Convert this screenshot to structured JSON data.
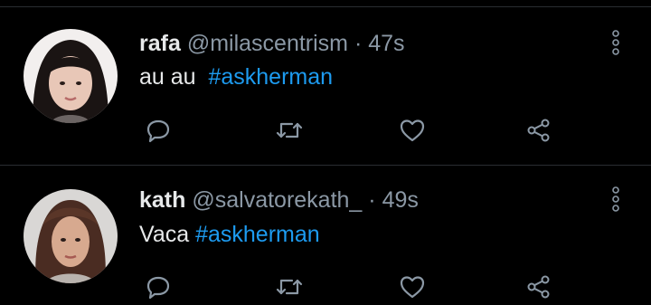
{
  "tweets": [
    {
      "name": "rafa",
      "handle": "@milascentrism",
      "separator": "·",
      "time": "47s",
      "text_prefix": "au au",
      "hashtag": "#askherman",
      "avatar": "avatar-photo"
    },
    {
      "name": "kath",
      "handle": "@salvatorekath_",
      "separator": "·",
      "time": "49s",
      "text_prefix": "Vaca",
      "hashtag": "#askherman",
      "avatar": "avatar-photo"
    }
  ],
  "icons": {
    "reply": "reply-icon",
    "retweet": "retweet-icon",
    "like": "heart-icon",
    "share": "share-icon",
    "menu": "more-vertical-icon"
  },
  "colors": {
    "background": "#000000",
    "text": "#e7e9ea",
    "muted": "#8b98a5",
    "hashtag": "#1d9bf0",
    "divider": "#2a2d31"
  }
}
